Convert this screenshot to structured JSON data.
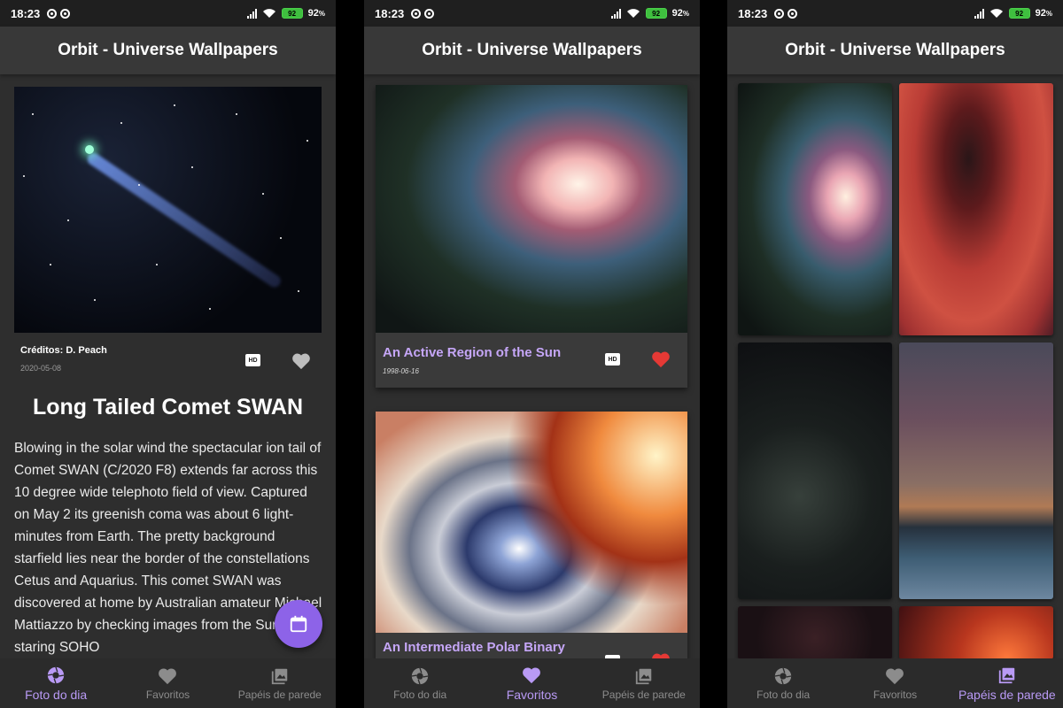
{
  "statusbar": {
    "time": "18:23",
    "battery_level": "92",
    "battery_label": "92",
    "battery_unit": "%"
  },
  "app_title": "Orbit - Universe Wallpapers",
  "nav": {
    "photo_of_day": "Foto do dia",
    "favorites": "Favoritos",
    "wallpapers": "Papéis de parede"
  },
  "hd_label": "HD",
  "apod": {
    "credits": "Créditos: D. Peach",
    "date": "2020-05-08",
    "title": "Long Tailed Comet SWAN",
    "explanation": "Blowing in the solar wind the spectacular ion tail of Comet SWAN (C/2020 F8) extends far across this 10 degree wide telephoto field of view. Captured on May 2 its greenish coma was about 6 light-minutes from Earth. The pretty background starfield lies near the border of the constellations Cetus and Aquarius. This comet SWAN was discovered at home by Australian amateur Michael Mattiazzo by checking images from the Sun-staring SOHO",
    "favorited": false
  },
  "favorites": [
    {
      "title": "An Active Region of the Sun",
      "date": "1998-06-16",
      "favorited": true
    },
    {
      "title": "An Intermediate Polar Binary",
      "favorited": true
    }
  ],
  "colors": {
    "accent": "#b99af5",
    "fab": "#8d63e8",
    "heart_active": "#e53935",
    "heart_inactive": "#bdbdbd"
  }
}
